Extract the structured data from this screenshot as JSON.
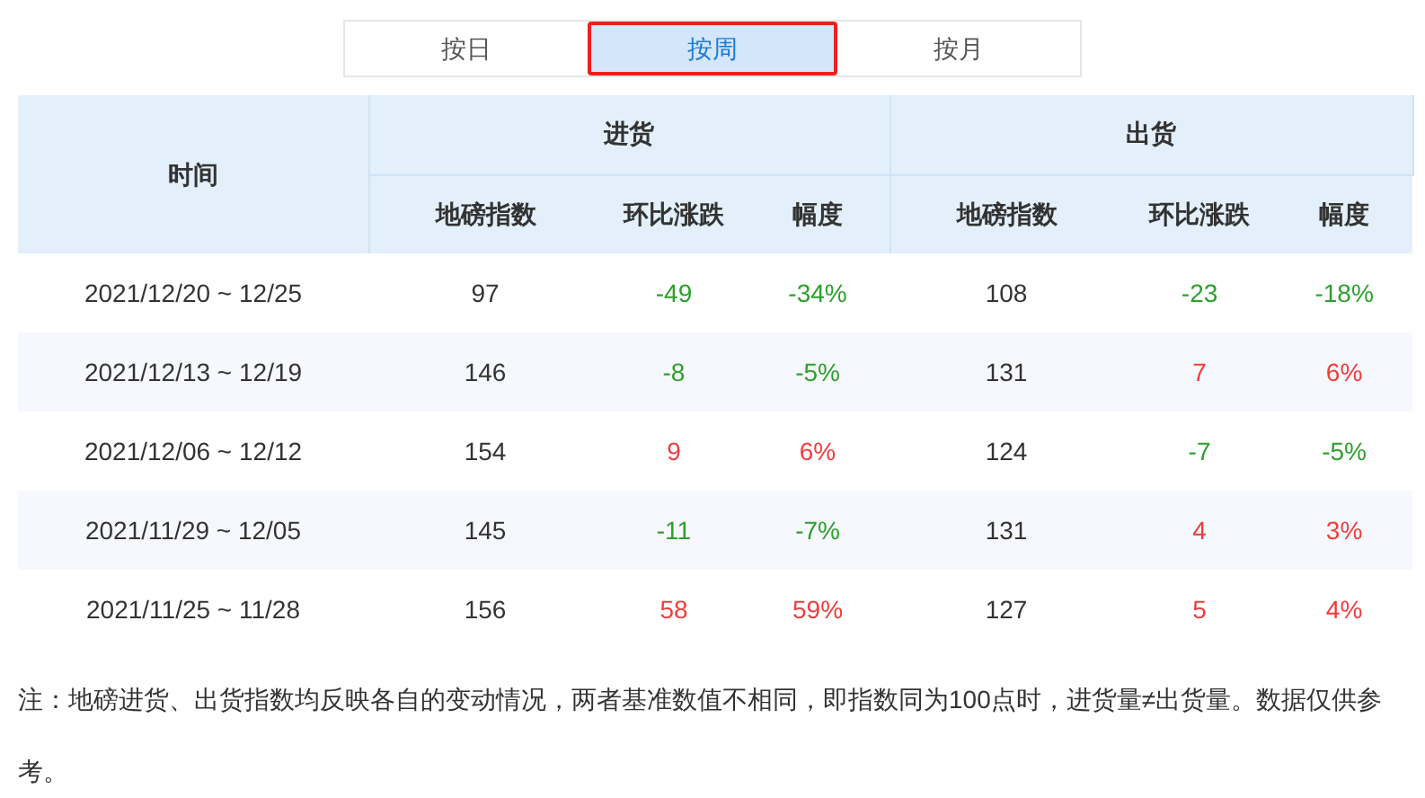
{
  "tabs": [
    {
      "label": "按日",
      "selected": false
    },
    {
      "label": "按周",
      "selected": true
    },
    {
      "label": "按月",
      "selected": false
    }
  ],
  "table": {
    "time_header": "时间",
    "groups": [
      "进货",
      "出货"
    ],
    "subheaders": [
      "地磅指数",
      "环比涨跌",
      "幅度",
      "地磅指数",
      "环比涨跌",
      "幅度"
    ],
    "rows": [
      {
        "time": "2021/12/20 ~ 12/25",
        "in": {
          "index": "97",
          "change": "-49",
          "pct": "-34%",
          "color": "#2ca02c"
        },
        "out": {
          "index": "108",
          "change": "-23",
          "pct": "-18%",
          "color": "#2ca02c"
        }
      },
      {
        "time": "2021/12/13 ~ 12/19",
        "in": {
          "index": "146",
          "change": "-8",
          "pct": "-5%",
          "color": "#2ca02c"
        },
        "out": {
          "index": "131",
          "change": "7",
          "pct": "6%",
          "color": "#f03c3c"
        }
      },
      {
        "time": "2021/12/06 ~ 12/12",
        "in": {
          "index": "154",
          "change": "9",
          "pct": "6%",
          "color": "#f03c3c"
        },
        "out": {
          "index": "124",
          "change": "-7",
          "pct": "-5%",
          "color": "#2ca02c"
        }
      },
      {
        "time": "2021/11/29 ~ 12/05",
        "in": {
          "index": "145",
          "change": "-11",
          "pct": "-7%",
          "color": "#2ca02c"
        },
        "out": {
          "index": "131",
          "change": "4",
          "pct": "3%",
          "color": "#f03c3c"
        }
      },
      {
        "time": "2021/11/25 ~ 11/28",
        "in": {
          "index": "156",
          "change": "58",
          "pct": "59%",
          "color": "#f03c3c"
        },
        "out": {
          "index": "127",
          "change": "5",
          "pct": "4%",
          "color": "#f03c3c"
        }
      }
    ]
  },
  "note": "注：地磅进货、出货指数均反映各自的变动情况，两者基准数值不相同，即指数同为100点时，进货量≠出货量。数据仅供参考。"
}
